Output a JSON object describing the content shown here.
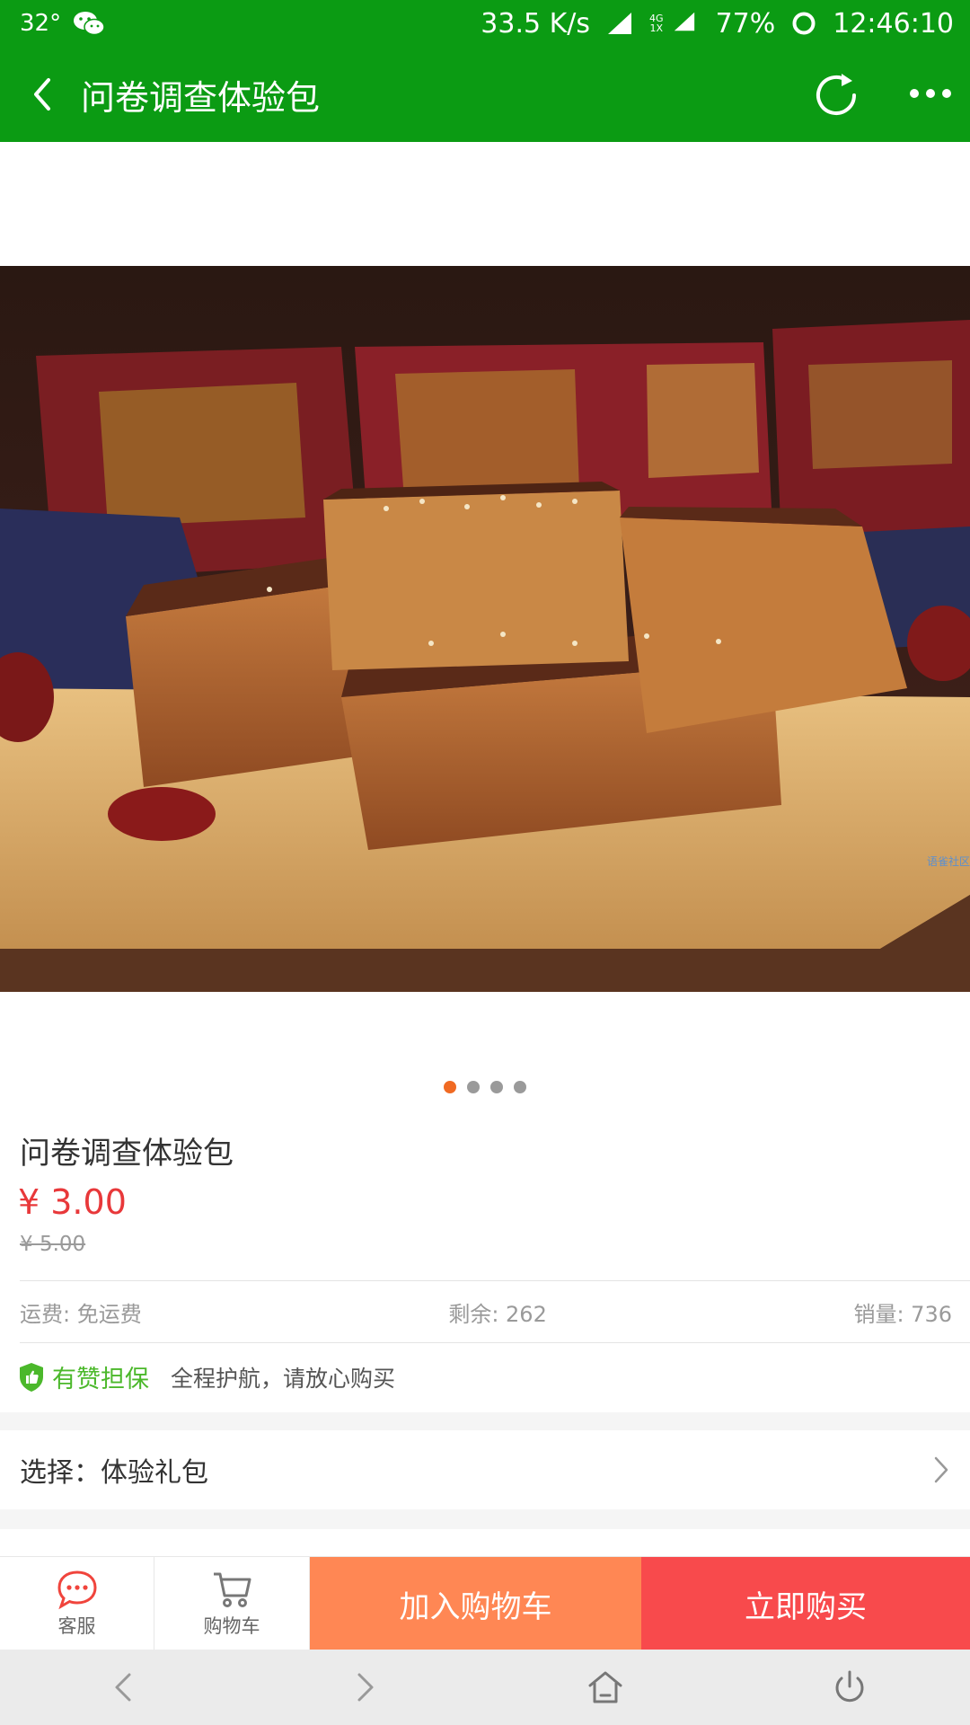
{
  "status_bar": {
    "temperature": "32°",
    "net_speed": "33.5 K/s",
    "net_type_top": "4G",
    "net_type_bottom": "1X",
    "battery": "77%",
    "time": "12:46:10",
    "icons": [
      "wechat-icon",
      "signal-icon",
      "signal-icon",
      "battery-ring-icon"
    ]
  },
  "title_bar": {
    "title": "问卷调查体验包",
    "icons": [
      "back-icon",
      "refresh-icon",
      "more-icon"
    ]
  },
  "gallery": {
    "watermark": "语雀社区",
    "dots_count": 4,
    "active_index": 0
  },
  "product": {
    "title": "问卷调查体验包",
    "price": "¥ 3.00",
    "original_price": "¥ 5.00"
  },
  "info": {
    "shipping": "运费: 免运费",
    "stock": "剩余: 262",
    "sales": "销量: 736"
  },
  "guarantee": {
    "label": "有赞担保",
    "text": "全程护航，请放心购买"
  },
  "option": {
    "text": "选择：体验礼包"
  },
  "bottom_bar": {
    "service_label": "客服",
    "cart_label": "购物车",
    "add_to_cart": "加入购物车",
    "buy_now": "立即购买"
  },
  "colors": {
    "header_green": "#0b9b13",
    "price_red": "#e8383a",
    "add_cart_orange": "#ff8754",
    "buy_now_red": "#f84a4c",
    "guarantee_green": "#4bb82b",
    "dot_active": "#f06a23"
  }
}
